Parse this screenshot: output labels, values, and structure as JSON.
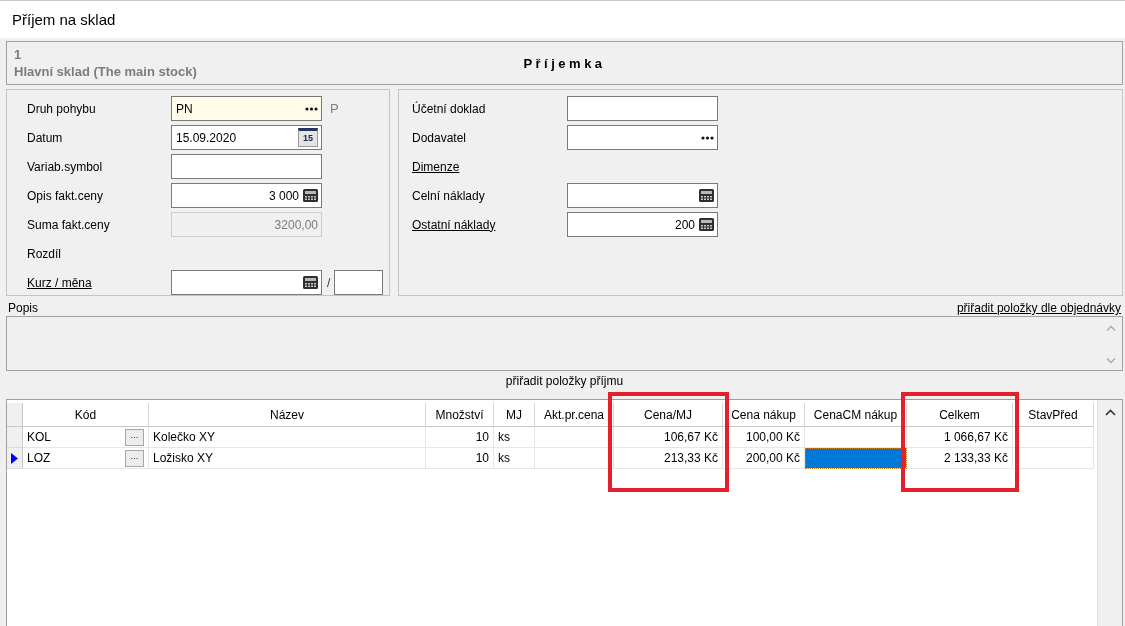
{
  "window": {
    "title": "Příjem na sklad"
  },
  "header": {
    "number": "1",
    "warehouse": "Hlavní sklad (The main stock)",
    "document": "Příjemka"
  },
  "left_fields": [
    {
      "kind": "lookup",
      "label": "Druh pohybu",
      "link": false,
      "required": true,
      "disabled": false,
      "value": "PN",
      "suffix": "P"
    },
    {
      "kind": "date",
      "label": "Datum",
      "link": false,
      "required": false,
      "disabled": false,
      "value": "15.09.2020",
      "button": "15"
    },
    {
      "kind": "text",
      "label": "Variab.symbol",
      "link": false,
      "required": false,
      "disabled": false
    },
    {
      "kind": "calc",
      "label": "Opis fakt.ceny",
      "link": false,
      "required": false,
      "disabled": false,
      "value": "3 000"
    },
    {
      "kind": "number",
      "label": "Suma fakt.ceny",
      "link": false,
      "required": false,
      "disabled": true,
      "value": "3200,00"
    },
    {
      "kind": "none",
      "label": "Rozdíl",
      "link": false
    },
    {
      "kind": "currency",
      "label": "Kurz / měna",
      "link": true,
      "required": false,
      "disabled": false,
      "separator": "/"
    }
  ],
  "right_fields": [
    {
      "kind": "text",
      "label": "Účetní doklad",
      "link": false,
      "required": false,
      "disabled": false
    },
    {
      "kind": "lookup",
      "label": "Dodavatel",
      "link": false,
      "required": false,
      "disabled": false
    },
    {
      "kind": "none",
      "label": "Dimenze",
      "link": true
    },
    {
      "kind": "calc",
      "label": "Celní náklady",
      "link": false,
      "required": false,
      "disabled": false
    },
    {
      "kind": "calc",
      "label": "Ostatní náklady",
      "link": true,
      "required": false,
      "disabled": false,
      "value": "200"
    }
  ],
  "description": {
    "label": "Popis",
    "order_link": "přiřadit položky dle objednávky"
  },
  "assign_items": "přiřadit položky příjmu",
  "grid": {
    "columns": [
      {
        "label": "Kód",
        "highlighted": false
      },
      {
        "label": "Název",
        "highlighted": false
      },
      {
        "label": "Množství",
        "highlighted": false
      },
      {
        "label": "MJ",
        "highlighted": false
      },
      {
        "label": "Akt.pr.cena",
        "highlighted": false
      },
      {
        "label": "Cena/MJ",
        "highlighted": true
      },
      {
        "label": "Cena nákup",
        "highlighted": false
      },
      {
        "label": "CenaCM nákup",
        "highlighted": false
      },
      {
        "label": "Celkem",
        "highlighted": true
      },
      {
        "label": "StavPřed",
        "highlighted": false
      }
    ],
    "rows": [
      {
        "selected": false,
        "lookup_button": "...",
        "cells": [
          {
            "text": "KOL",
            "selected": false
          },
          {
            "text": "Kolečko XY",
            "selected": false
          },
          {
            "text": "10",
            "selected": false
          },
          {
            "text": "ks",
            "selected": false
          },
          {
            "selected": false
          },
          {
            "text": "106,67 Kč",
            "selected": false
          },
          {
            "text": "100,00 Kč",
            "selected": false
          },
          {
            "selected": false
          },
          {
            "text": "1 066,67 Kč",
            "selected": false
          },
          {
            "selected": false
          }
        ]
      },
      {
        "selected": true,
        "lookup_button": "...",
        "cells": [
          {
            "text": "LOZ",
            "selected": false
          },
          {
            "text": "Ložisko XY",
            "selected": false
          },
          {
            "text": "10",
            "selected": false
          },
          {
            "text": "ks",
            "selected": false
          },
          {
            "selected": false
          },
          {
            "text": "213,33 Kč",
            "selected": false
          },
          {
            "text": "200,00 Kč",
            "selected": false
          },
          {
            "selected": true
          },
          {
            "text": "2 133,33 Kč",
            "selected": false
          },
          {
            "selected": false
          }
        ]
      }
    ]
  }
}
